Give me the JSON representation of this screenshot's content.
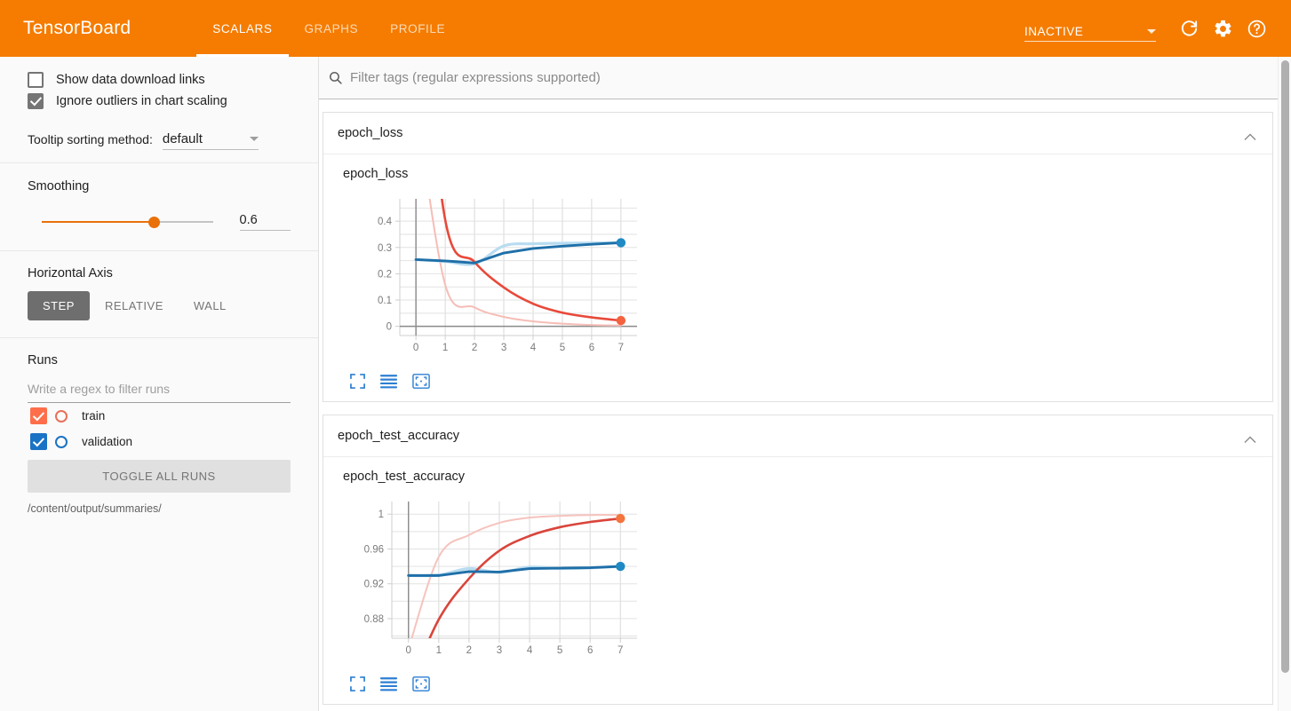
{
  "header": {
    "brand": "TensorBoard",
    "tabs": [
      {
        "label": "SCALARS",
        "active": true
      },
      {
        "label": "GRAPHS",
        "active": false
      },
      {
        "label": "PROFILE",
        "active": false
      }
    ],
    "run_selector_value": "INACTIVE",
    "icons": [
      "refresh-icon",
      "gear-icon",
      "help-icon"
    ],
    "accent_color": "#f57c00"
  },
  "sidebar": {
    "checkboxes": [
      {
        "label": "Show data download links",
        "checked": false
      },
      {
        "label": "Ignore outliers in chart scaling",
        "checked": true
      }
    ],
    "tooltip_sorting": {
      "label": "Tooltip sorting method:",
      "value": "default"
    },
    "smoothing": {
      "title": "Smoothing",
      "value": "0.6",
      "fraction": 0.6
    },
    "horizontal_axis": {
      "title": "Horizontal Axis",
      "options": [
        {
          "label": "STEP",
          "active": true
        },
        {
          "label": "RELATIVE",
          "active": false
        },
        {
          "label": "WALL",
          "active": false
        }
      ]
    },
    "runs": {
      "title": "Runs",
      "filter_placeholder": "Write a regex to filter runs",
      "items": [
        {
          "label": "train",
          "checked": true,
          "color": "#ff6e4a"
        },
        {
          "label": "validation",
          "checked": true,
          "color": "#1a73c4"
        }
      ],
      "toggle_all_label": "TOGGLE ALL RUNS",
      "logdir": "/content/output/summaries/"
    }
  },
  "main": {
    "filter_placeholder": "Filter tags (regular expressions supported)",
    "cards": [
      {
        "header": "epoch_loss",
        "chart_index": 0
      },
      {
        "header": "epoch_test_accuracy",
        "chart_index": 1
      }
    ],
    "chart_tool_icons": [
      "fullscreen-icon",
      "data-table-icon",
      "fit-domain-icon"
    ]
  },
  "chart_data": [
    {
      "type": "line",
      "title": "epoch_loss",
      "xlabel": "",
      "ylabel": "",
      "grid": true,
      "legend": "none",
      "x": [
        0,
        1,
        2,
        3,
        4,
        5,
        6,
        7
      ],
      "xticks": [
        0,
        1,
        2,
        3,
        4,
        5,
        6,
        7
      ],
      "yticks": [
        0,
        0.1,
        0.2,
        0.3,
        0.4
      ],
      "xlim": [
        -0.55,
        7.55
      ],
      "ylim": [
        -0.035,
        0.485
      ],
      "series": [
        {
          "name": "train",
          "color": "#e8493a",
          "smoothed": true,
          "values": [
            1.42,
            0.405,
            0.245,
            0.148,
            0.086,
            0.052,
            0.034,
            0.022
          ]
        },
        {
          "name": "train_raw",
          "color": "#f6bdb6",
          "smoothed": false,
          "values": [
            0.85,
            0.158,
            0.072,
            0.036,
            0.019,
            0.01,
            0.005,
            0.003
          ]
        },
        {
          "name": "validation",
          "color": "#1f6fa8",
          "smoothed": true,
          "values": [
            0.254,
            0.249,
            0.241,
            0.279,
            0.296,
            0.305,
            0.312,
            0.318
          ]
        },
        {
          "name": "validation_raw",
          "color": "#b8dcf0",
          "smoothed": false,
          "values": [
            0.254,
            0.247,
            0.238,
            0.306,
            0.314,
            0.316,
            0.317,
            0.318
          ]
        }
      ],
      "end_markers": [
        {
          "series": "train",
          "x": 7,
          "y": 0.022,
          "color": "#f4623f"
        },
        {
          "series": "validation",
          "x": 7,
          "y": 0.318,
          "color": "#1f8ac4"
        }
      ]
    },
    {
      "type": "line",
      "title": "epoch_test_accuracy",
      "xlabel": "",
      "ylabel": "",
      "grid": true,
      "legend": "none",
      "x": [
        0,
        1,
        2,
        3,
        4,
        5,
        6,
        7
      ],
      "xticks": [
        0,
        1,
        2,
        3,
        4,
        5,
        6,
        7
      ],
      "yticks": [
        0.88,
        0.92,
        0.96,
        1
      ],
      "xlim": [
        -0.55,
        7.55
      ],
      "ylim": [
        0.8575,
        1.0145
      ],
      "series": [
        {
          "name": "train",
          "color": "#d9453b",
          "smoothed": true,
          "values": [
            0.8,
            0.879,
            0.926,
            0.958,
            0.975,
            0.985,
            0.991,
            0.995
          ]
        },
        {
          "name": "train_raw",
          "color": "#f6c3bd",
          "smoothed": false,
          "values": [
            0.845,
            0.951,
            0.976,
            0.99,
            0.996,
            0.998,
            0.999,
            0.999
          ]
        },
        {
          "name": "validation",
          "color": "#1f6fa8",
          "smoothed": true,
          "values": [
            0.9295,
            0.9295,
            0.934,
            0.9335,
            0.9375,
            0.938,
            0.9385,
            0.94
          ]
        },
        {
          "name": "validation_raw",
          "color": "#b8dcf0",
          "smoothed": false,
          "values": [
            0.9295,
            0.93,
            0.9375,
            0.933,
            0.9392,
            0.9376,
            0.9382,
            0.94
          ]
        }
      ],
      "end_markers": [
        {
          "series": "train",
          "x": 7,
          "y": 0.995,
          "color": "#f4743f"
        },
        {
          "series": "validation",
          "x": 7,
          "y": 0.94,
          "color": "#1f8ac4"
        }
      ]
    }
  ]
}
